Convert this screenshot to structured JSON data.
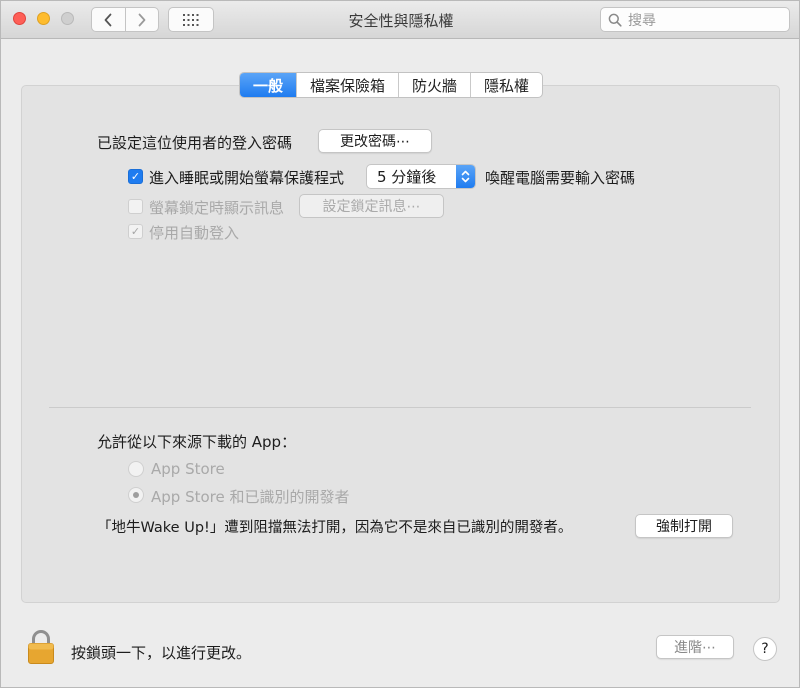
{
  "window": {
    "title": "安全性與隱私權",
    "search_placeholder": "搜尋"
  },
  "tabs": [
    {
      "label": "一般",
      "active": true
    },
    {
      "label": "檔案保險箱",
      "active": false
    },
    {
      "label": "防火牆",
      "active": false
    },
    {
      "label": "隱私權",
      "active": false
    }
  ],
  "general": {
    "password_label": "已設定這位使用者的登入密碼",
    "change_password_button": "更改密碼⋯",
    "require_password": {
      "label": "進入睡眠或開始螢幕保護程式",
      "checked": true,
      "delay_value": "5 分鐘後",
      "suffix": "喚醒電腦需要輸入密碼"
    },
    "show_message": {
      "label": "螢幕鎖定時顯示訊息",
      "checked": false,
      "set_message_button": "設定鎖定訊息⋯"
    },
    "disable_auto_login": {
      "label": "停用自動登入",
      "checked": true
    }
  },
  "downloads": {
    "heading": "允許從以下來源下載的 App：",
    "options": [
      {
        "label": "App Store",
        "selected": false
      },
      {
        "label": "App Store 和已識別的開發者",
        "selected": true
      }
    ],
    "blocked_message": "「地牛Wake Up!」遭到阻擋無法打開，因為它不是來自已識別的開發者。",
    "open_anyway_button": "強制打開"
  },
  "footer": {
    "lock_message": "按鎖頭一下，以進行更改。",
    "advanced_button": "進階⋯",
    "help_button": "?"
  },
  "colors": {
    "accent": "#1f7cf0",
    "close": "#fe5f57",
    "minimize": "#febc2e",
    "lock": "#e7a630"
  }
}
